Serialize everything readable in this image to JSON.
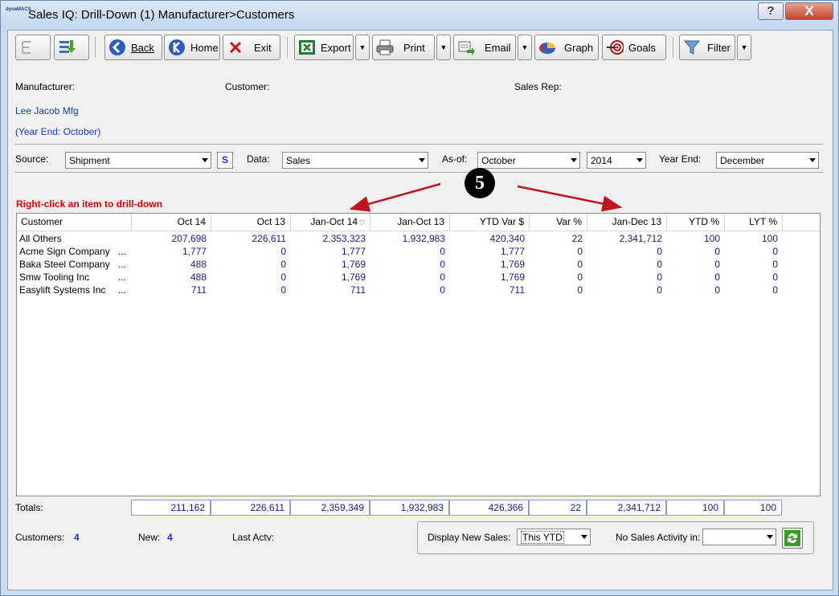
{
  "window": {
    "app_icon_text": "dynaMACS",
    "title": "Sales IQ: Drill-Down (1) Manufacturer>Customers",
    "help_label": "?",
    "close_label": "X"
  },
  "toolbar": {
    "back": "Back",
    "home": "Home",
    "exit": "Exit",
    "export": "Export",
    "print": "Print",
    "email": "Email",
    "graph": "Graph",
    "goals": "Goals",
    "filter": "Filter"
  },
  "header": {
    "manufacturer_label": "Manufacturer:",
    "customer_label": "Customer:",
    "sales_rep_label": "Sales Rep:",
    "manufacturer_value": "Lee Jacob Mfg",
    "year_end_note": "(Year End: October)"
  },
  "filters": {
    "source_label": "Source:",
    "source_value": "Shipment",
    "s_button": "S",
    "data_label": "Data:",
    "data_value": "Sales",
    "asof_label": "As-of:",
    "asof_month": "October",
    "asof_year": "2014",
    "year_end_label": "Year End:",
    "year_end_value": "December"
  },
  "callout_number": "5",
  "hint": "Right-click an item to drill-down",
  "grid": {
    "columns": [
      "Customer",
      "Oct 14",
      "Oct 13",
      "Jan-Oct 14",
      "Jan-Oct 13",
      "YTD Var $",
      "Var %",
      "Jan-Dec 13",
      "YTD %",
      "LYT %"
    ],
    "rows": [
      {
        "name": "All Others",
        "dots": "",
        "values": [
          "207,698",
          "226,611",
          "2,353,323",
          "1,932,983",
          "420,340",
          "22",
          "2,341,712",
          "100",
          "100"
        ]
      },
      {
        "name": "Acme Sign Company",
        "dots": "...",
        "values": [
          "1,777",
          "0",
          "1,777",
          "0",
          "1,777",
          "0",
          "0",
          "0",
          "0"
        ]
      },
      {
        "name": "Baka Steel Company",
        "dots": "...",
        "values": [
          "488",
          "0",
          "1,769",
          "0",
          "1,769",
          "0",
          "0",
          "0",
          "0"
        ]
      },
      {
        "name": "Smw Tooling Inc",
        "dots": "...",
        "values": [
          "488",
          "0",
          "1,769",
          "0",
          "1,769",
          "0",
          "0",
          "0",
          "0"
        ]
      },
      {
        "name": "Easylift Systems Inc",
        "dots": "...",
        "values": [
          "711",
          "0",
          "711",
          "0",
          "711",
          "0",
          "0",
          "0",
          "0"
        ]
      }
    ]
  },
  "totals": {
    "label": "Totals:",
    "values": [
      "211,162",
      "226,611",
      "2,359,349",
      "1,932,983",
      "426,366",
      "22",
      "2,341,712",
      "100",
      "100"
    ]
  },
  "footer": {
    "customers_label": "Customers:",
    "customers_value": "4",
    "new_label": "New:",
    "new_value": "4",
    "last_actv_label": "Last Actv:",
    "display_new_sales_label": "Display New Sales:",
    "display_new_sales_value": "This YTD",
    "no_sales_label": "No Sales Activity in:",
    "no_sales_value": ""
  },
  "colors": {
    "accent_blue": "#1a3cc8",
    "hint_red": "#e00000",
    "arrow_red": "#c0141e"
  }
}
